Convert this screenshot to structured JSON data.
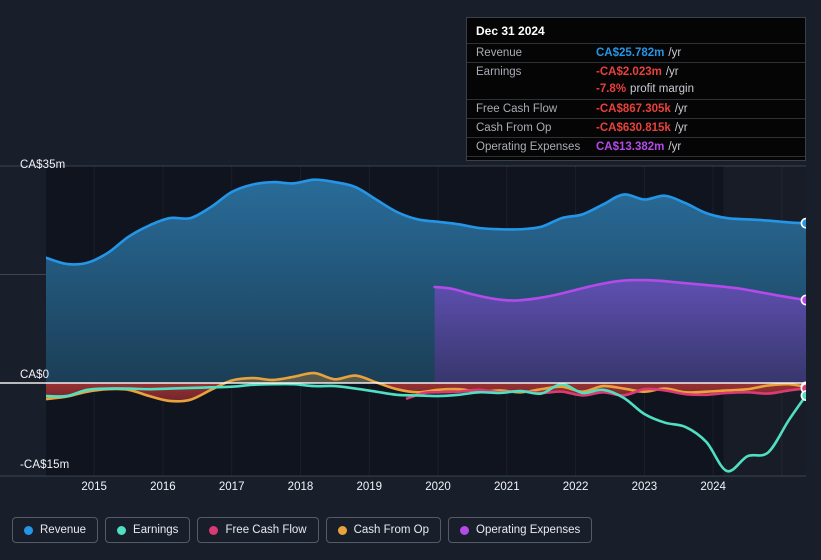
{
  "chart_data": {
    "type": "area",
    "title": "",
    "xlabel": "",
    "ylabel": "",
    "currency": "CA$",
    "grid": true,
    "legend_position": "bottom",
    "ylim": [
      -15,
      35
    ],
    "y_ticks": [
      {
        "value": 35,
        "label": "CA$35m"
      },
      {
        "value": 0,
        "label": "CA$0"
      },
      {
        "value": -15,
        "label": "-CA$15m"
      }
    ],
    "x_ticks": [
      "2015",
      "2016",
      "2017",
      "2018",
      "2019",
      "2020",
      "2021",
      "2022",
      "2023",
      "2024"
    ],
    "xlim": [
      2014.3,
      2025.35
    ],
    "forecast_start": 2024.15,
    "series": [
      {
        "name": "Revenue",
        "color": "#2496e8",
        "fill": "#1d4b6e",
        "x": [
          2014.3,
          2014.6,
          2014.9,
          2015.2,
          2015.5,
          2015.8,
          2016.1,
          2016.4,
          2016.7,
          2017.0,
          2017.3,
          2017.6,
          2017.9,
          2018.2,
          2018.5,
          2018.8,
          2019.1,
          2019.4,
          2019.7,
          2020.0,
          2020.3,
          2020.6,
          2020.9,
          2021.2,
          2021.5,
          2021.8,
          2022.1,
          2022.4,
          2022.7,
          2023.0,
          2023.3,
          2023.6,
          2023.9,
          2024.2,
          2024.5,
          2024.8,
          2025.1,
          2025.35
        ],
        "values": [
          20.2,
          19.2,
          19.4,
          21.0,
          23.6,
          25.4,
          26.6,
          26.6,
          28.4,
          30.8,
          32.0,
          32.4,
          32.2,
          32.8,
          32.4,
          31.6,
          29.6,
          27.6,
          26.4,
          26.0,
          25.6,
          25.0,
          24.8,
          24.8,
          25.2,
          26.6,
          27.2,
          28.8,
          30.4,
          29.6,
          30.2,
          29.0,
          27.4,
          26.6,
          26.4,
          26.2,
          25.9,
          25.782
        ]
      },
      {
        "name": "Earnings",
        "color": "#4fdfc2",
        "x": [
          2014.3,
          2014.6,
          2014.9,
          2015.2,
          2015.5,
          2015.8,
          2016.1,
          2016.4,
          2016.7,
          2017.0,
          2017.3,
          2017.6,
          2017.9,
          2018.2,
          2018.5,
          2018.8,
          2019.1,
          2019.4,
          2019.7,
          2020.0,
          2020.3,
          2020.6,
          2020.9,
          2021.2,
          2021.5,
          2021.8,
          2022.1,
          2022.4,
          2022.7,
          2023.0,
          2023.3,
          2023.6,
          2023.9,
          2024.2,
          2024.5,
          2024.8,
          2025.1,
          2025.35
        ],
        "values": [
          -2.1,
          -2.1,
          -1.1,
          -0.9,
          -0.9,
          -1.0,
          -0.9,
          -0.8,
          -0.7,
          -0.6,
          -0.3,
          -0.2,
          -0.2,
          -0.5,
          -0.5,
          -0.9,
          -1.4,
          -1.9,
          -2.0,
          -2.1,
          -1.9,
          -1.5,
          -1.6,
          -1.3,
          -1.7,
          -0.2,
          -1.6,
          -1.1,
          -2.4,
          -5.0,
          -6.4,
          -7.1,
          -9.5,
          -14.2,
          -11.8,
          -11.2,
          -6.0,
          -2.023
        ]
      },
      {
        "name": "Free Cash Flow",
        "color": "#da3b74",
        "x": [
          2019.55,
          2019.8,
          2020.0,
          2020.3,
          2020.6,
          2020.9,
          2021.2,
          2021.5,
          2021.8,
          2022.1,
          2022.4,
          2022.7,
          2023.0,
          2023.3,
          2023.6,
          2023.9,
          2024.2,
          2024.5,
          2024.8,
          2025.1,
          2025.35
        ],
        "values": [
          -2.5,
          -1.6,
          -1.5,
          -1.4,
          -1.1,
          -1.5,
          -1.3,
          -1.6,
          -1.4,
          -2.0,
          -1.5,
          -2.0,
          -1.0,
          -1.2,
          -1.8,
          -1.9,
          -1.6,
          -1.5,
          -1.7,
          -1.2,
          -0.867
        ]
      },
      {
        "name": "Cash From Op",
        "color": "#e8a33d",
        "x": [
          2014.3,
          2014.6,
          2014.9,
          2015.2,
          2015.5,
          2015.8,
          2016.1,
          2016.4,
          2016.7,
          2017.0,
          2017.3,
          2017.6,
          2017.9,
          2018.2,
          2018.5,
          2018.8,
          2019.1,
          2019.4,
          2019.7,
          2020.0,
          2020.3,
          2020.6,
          2020.9,
          2021.2,
          2021.5,
          2021.8,
          2022.1,
          2022.4,
          2022.7,
          2023.0,
          2023.3,
          2023.6,
          2023.9,
          2024.2,
          2024.5,
          2024.8,
          2025.1,
          2025.35
        ],
        "values": [
          -2.6,
          -2.2,
          -1.4,
          -1.0,
          -1.1,
          -2.1,
          -2.9,
          -2.7,
          -1.1,
          0.4,
          0.8,
          0.5,
          1.0,
          1.6,
          0.6,
          1.2,
          0.1,
          -1.0,
          -1.5,
          -1.1,
          -1.0,
          -1.4,
          -1.2,
          -1.5,
          -1.0,
          -0.6,
          -1.4,
          -0.5,
          -0.9,
          -1.4,
          -0.9,
          -1.5,
          -1.4,
          -1.2,
          -1.0,
          -0.4,
          -0.2,
          -0.631
        ]
      },
      {
        "name": "Operating Expenses",
        "color": "#b44ae8",
        "fill": "#4a3a86",
        "x": [
          2019.95,
          2020.2,
          2020.5,
          2020.8,
          2021.1,
          2021.4,
          2021.7,
          2022.0,
          2022.3,
          2022.6,
          2022.9,
          2023.2,
          2023.5,
          2023.8,
          2024.1,
          2024.4,
          2024.7,
          2025.0,
          2025.35
        ],
        "values": [
          15.5,
          15.2,
          14.3,
          13.6,
          13.3,
          13.6,
          14.2,
          15.0,
          15.8,
          16.4,
          16.6,
          16.5,
          16.2,
          15.9,
          15.6,
          15.2,
          14.6,
          14.0,
          13.382
        ]
      }
    ]
  },
  "y_axis": {
    "top": "CA$35m",
    "zero": "CA$0",
    "bottom": "-CA$15m"
  },
  "x_axis": {
    "ticks": [
      "2015",
      "2016",
      "2017",
      "2018",
      "2019",
      "2020",
      "2021",
      "2022",
      "2023",
      "2024"
    ]
  },
  "tooltip": {
    "date": "Dec 31 2024",
    "rows": [
      {
        "label": "Revenue",
        "value": "CA$25.782m",
        "unit": "/yr",
        "color": "#2496e8"
      },
      {
        "label": "Earnings",
        "value": "-CA$2.023m",
        "unit": "/yr",
        "color": "#e8413c"
      },
      {
        "label": "",
        "value": "-7.8%",
        "unit": "profit margin",
        "color": "#e8413c"
      },
      {
        "label": "Free Cash Flow",
        "value": "-CA$867.305k",
        "unit": "/yr",
        "color": "#e8413c"
      },
      {
        "label": "Cash From Op",
        "value": "-CA$630.815k",
        "unit": "/yr",
        "color": "#e8413c"
      },
      {
        "label": "Operating Expenses",
        "value": "CA$13.382m",
        "unit": "/yr",
        "color": "#b44ae8"
      }
    ]
  },
  "legend": {
    "items": [
      {
        "label": "Revenue",
        "color": "#2496e8"
      },
      {
        "label": "Earnings",
        "color": "#4fdfc2"
      },
      {
        "label": "Free Cash Flow",
        "color": "#da3b74"
      },
      {
        "label": "Cash From Op",
        "color": "#e8a33d"
      },
      {
        "label": "Operating Expenses",
        "color": "#b44ae8"
      }
    ]
  },
  "colors": {
    "background": "#191e2b",
    "plot_background": "#10141f",
    "zero_line": "#ffffff",
    "negative_fill": "#8d2a2a"
  }
}
